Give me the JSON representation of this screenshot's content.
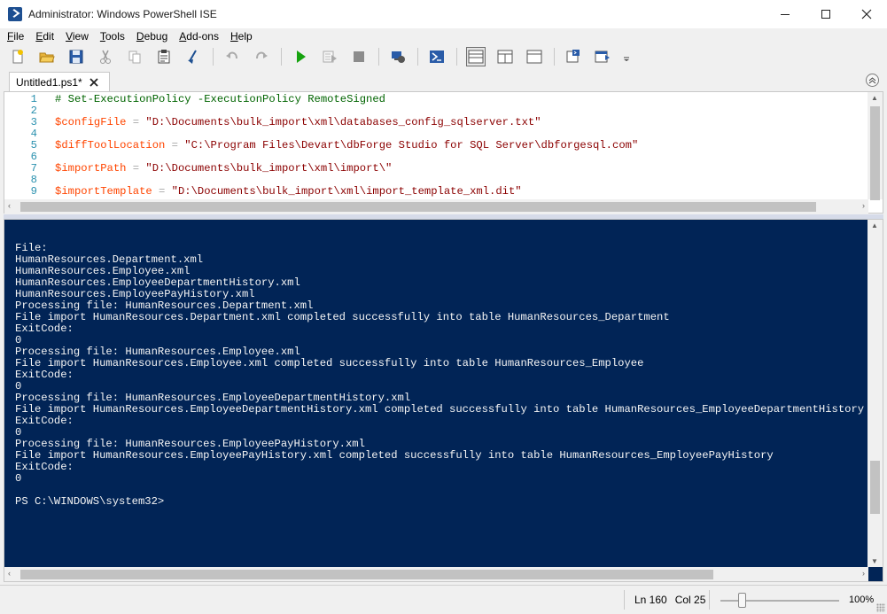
{
  "window": {
    "title": "Administrator: Windows PowerShell ISE"
  },
  "menu": {
    "items": [
      {
        "label": "File",
        "key": "F",
        "rest": "ile"
      },
      {
        "label": "Edit",
        "key": "E",
        "rest": "dit"
      },
      {
        "label": "View",
        "key": "V",
        "rest": "iew"
      },
      {
        "label": "Tools",
        "key": "T",
        "rest": "ools"
      },
      {
        "label": "Debug",
        "key": "D",
        "rest": "ebug"
      },
      {
        "label": "Add-ons",
        "key": "A",
        "rest": "dd-ons"
      },
      {
        "label": "Help",
        "key": "H",
        "rest": "elp"
      }
    ]
  },
  "toolbar": {
    "buttons": [
      "new-icon",
      "open-icon",
      "save-icon",
      "cut-icon",
      "copy-icon",
      "paste-icon",
      "clear-console-icon",
      "undo-icon",
      "redo-icon",
      "run-script-icon",
      "run-selection-icon",
      "stop-icon",
      "remote-powershell-icon",
      "powershell-console-icon",
      "show-script-top-icon",
      "show-script-right-icon",
      "show-script-maximized-icon",
      "command-window-icon",
      "command-addon-icon",
      "toolbar-overflow-icon"
    ]
  },
  "tabs": [
    {
      "label": "Untitled1.ps1*"
    }
  ],
  "editor": {
    "lines": [
      {
        "n": "1",
        "comment": "# Set-ExecutionPolicy -ExecutionPolicy RemoteSigned"
      },
      {
        "n": "2"
      },
      {
        "n": "3",
        "var": "$configFile",
        "op": " = ",
        "str": "\"D:\\Documents\\bulk_import\\xml\\databases_config_sqlserver.txt\""
      },
      {
        "n": "4"
      },
      {
        "n": "5",
        "var": "$diffToolLocation",
        "op": " = ",
        "str": "\"C:\\Program Files\\Devart\\dbForge Studio for SQL Server\\dbforgesql.com\""
      },
      {
        "n": "6"
      },
      {
        "n": "7",
        "var": "$importPath",
        "op": " = ",
        "str": "\"D:\\Documents\\bulk_import\\xml\\import\\\""
      },
      {
        "n": "8"
      },
      {
        "n": "9",
        "var": "$importTemplate",
        "op": " = ",
        "str": "\"D:\\Documents\\bulk_import\\xml\\import_template_xml.dit\""
      }
    ]
  },
  "console": {
    "lines": [
      "File:",
      "HumanResources.Department.xml",
      "HumanResources.Employee.xml",
      "HumanResources.EmployeeDepartmentHistory.xml",
      "HumanResources.EmployeePayHistory.xml",
      "Processing file: HumanResources.Department.xml",
      "File import HumanResources.Department.xml completed successfully into table HumanResources_Department",
      "ExitCode:",
      "0",
      "Processing file: HumanResources.Employee.xml",
      "File import HumanResources.Employee.xml completed successfully into table HumanResources_Employee",
      "ExitCode:",
      "0",
      "Processing file: HumanResources.EmployeeDepartmentHistory.xml",
      "File import HumanResources.EmployeeDepartmentHistory.xml completed successfully into table HumanResources_EmployeeDepartmentHistory",
      "ExitCode:",
      "0",
      "Processing file: HumanResources.EmployeePayHistory.xml",
      "File import HumanResources.EmployeePayHistory.xml completed successfully into table HumanResources_EmployeePayHistory",
      "ExitCode:",
      "0",
      "",
      "PS C:\\WINDOWS\\system32>"
    ]
  },
  "status": {
    "line": "Ln 160",
    "col": "Col 25",
    "zoom": "100%",
    "zoom_level": 0.18
  },
  "colors": {
    "console_bg": "#012456",
    "console_fg": "#f5f5f5",
    "comment": "#006400",
    "variable": "#ff4500",
    "string": "#8b0000",
    "line_number": "#2b91af"
  }
}
